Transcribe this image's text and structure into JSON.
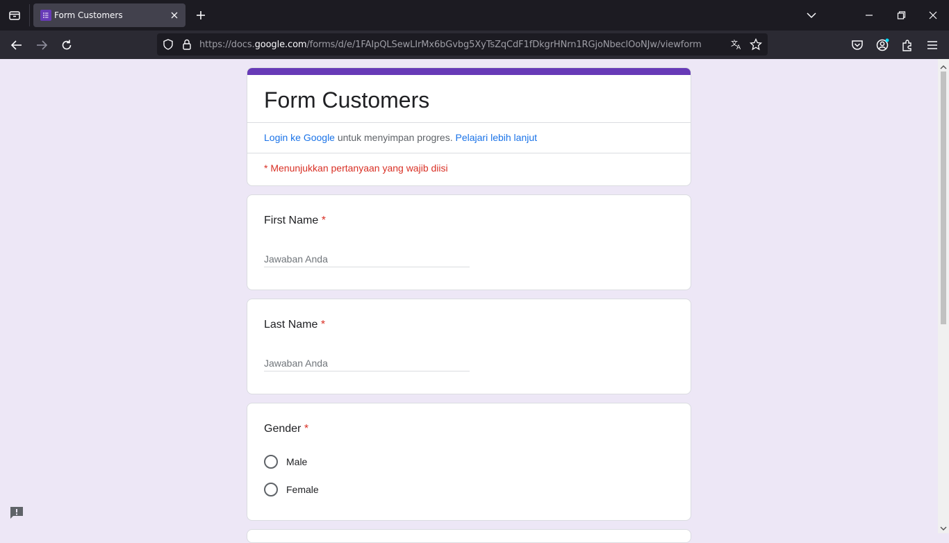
{
  "browser": {
    "tab_title": "Form Customers",
    "url_prefix": "https://docs.",
    "url_host": "google.com",
    "url_path": "/forms/d/e/1FAIpQLSewLIrMx6bGvbg5XyTsZqCdF1fDkgrHNrn1RGjoNbeclOoNJw/viewform",
    "accent_color": "#673ab7"
  },
  "form": {
    "title": "Form Customers",
    "login_link": "Login ke Google",
    "login_text": " untuk menyimpan progres. ",
    "learn_more_link": "Pelajari lebih lanjut",
    "required_note": "* Menunjukkan pertanyaan yang wajib diisi",
    "questions": [
      {
        "title": "First Name",
        "required_mark": "*",
        "placeholder": "Jawaban Anda"
      },
      {
        "title": "Last Name",
        "required_mark": "*",
        "placeholder": "Jawaban Anda"
      },
      {
        "title": "Gender",
        "required_mark": "*",
        "options": [
          "Male",
          "Female"
        ]
      }
    ]
  }
}
